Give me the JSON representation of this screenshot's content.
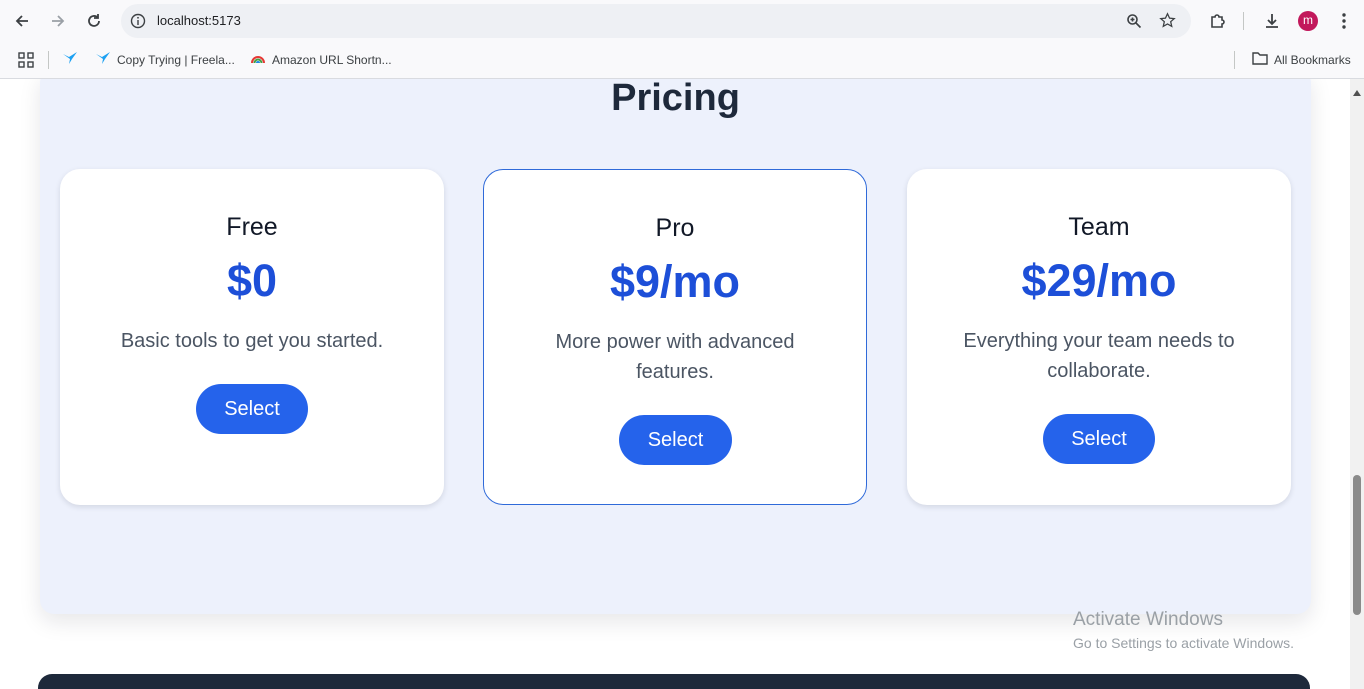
{
  "browser": {
    "url": "localhost:5173",
    "avatar_letter": "m",
    "bookmarks": [
      {
        "label": ""
      },
      {
        "label": "Copy Trying | Freela..."
      },
      {
        "label": "Amazon URL Shortn..."
      }
    ],
    "all_bookmarks": "All Bookmarks"
  },
  "pricing": {
    "title": "Pricing",
    "plans": [
      {
        "name": "Free",
        "price": "$0",
        "description": "Basic tools to get you started.",
        "button": "Select"
      },
      {
        "name": "Pro",
        "price": "$9/mo",
        "description": "More power with advanced features.",
        "button": "Select"
      },
      {
        "name": "Team",
        "price": "$29/mo",
        "description": "Everything your team needs to collaborate.",
        "button": "Select"
      }
    ]
  },
  "watermark": {
    "line1": "Activate Windows",
    "line2": "Go to Settings to activate Windows."
  },
  "colors": {
    "accent": "#2563eb",
    "price": "#1d4fd8",
    "section_bg": "#edf1fc",
    "footer": "#1e293b"
  }
}
